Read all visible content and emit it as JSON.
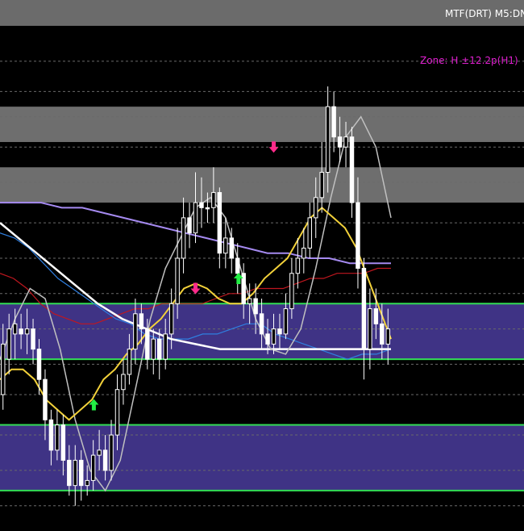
{
  "header": {
    "title": "MTF(DRT) M5:DN"
  },
  "zone_label": "Zone: H ±12.2p(H1)",
  "colors": {
    "background": "#000000",
    "header_bar": "#6b6b6b",
    "gray_zone": "#6e6e6e",
    "purple_zone": "#3f3385",
    "green_line": "#33dd55",
    "dashed_grid": "#6a6a6a",
    "candle": "#ffffff",
    "yellow_ma": "#f2d13a",
    "red_ma": "#c0171f",
    "blue_ma": "#2f7fe0",
    "violet_ma": "#a58af0",
    "white_ma": "#ffffff",
    "gray_osc": "#c0c0c0",
    "arrow_up": "#22ee44",
    "arrow_down": "#ff2a8a",
    "zone_text": "#e020d0"
  },
  "chart_data": {
    "type": "candlestick",
    "title": "MTF(DRT) M5:DN",
    "y_scale": "price index (unlabelled, 0 = top, 1 = bottom of plot)",
    "gray_zones": [
      [
        0.16,
        0.23
      ],
      [
        0.28,
        0.35
      ]
    ],
    "purple_zones": [
      [
        0.55,
        0.66
      ],
      [
        0.79,
        0.92
      ]
    ],
    "green_lines": [
      0.55,
      0.66,
      0.79,
      0.92
    ],
    "dashed_grid_levels": [
      0.07,
      0.13,
      0.18,
      0.24,
      0.31,
      0.39,
      0.46,
      0.53,
      0.6,
      0.67,
      0.73,
      0.81,
      0.88,
      0.95
    ],
    "candles": [
      [
        0.73,
        0.63,
        0.59,
        0.76
      ],
      [
        0.66,
        0.6,
        0.57,
        0.69
      ],
      [
        0.61,
        0.59,
        0.56,
        0.66
      ],
      [
        0.6,
        0.61,
        0.57,
        0.64
      ],
      [
        0.61,
        0.6,
        0.56,
        0.65
      ],
      [
        0.6,
        0.64,
        0.58,
        0.67
      ],
      [
        0.64,
        0.7,
        0.62,
        0.73
      ],
      [
        0.7,
        0.78,
        0.68,
        0.82
      ],
      [
        0.78,
        0.84,
        0.76,
        0.87
      ],
      [
        0.84,
        0.79,
        0.76,
        0.86
      ],
      [
        0.79,
        0.86,
        0.77,
        0.89
      ],
      [
        0.86,
        0.91,
        0.83,
        0.93
      ],
      [
        0.91,
        0.86,
        0.83,
        0.95
      ],
      [
        0.86,
        0.91,
        0.84,
        0.94
      ],
      [
        0.91,
        0.9,
        0.87,
        0.93
      ],
      [
        0.9,
        0.85,
        0.82,
        0.92
      ],
      [
        0.85,
        0.84,
        0.8,
        0.88
      ],
      [
        0.84,
        0.88,
        0.81,
        0.9
      ],
      [
        0.88,
        0.81,
        0.78,
        0.9
      ],
      [
        0.81,
        0.72,
        0.69,
        0.84
      ],
      [
        0.72,
        0.69,
        0.66,
        0.75
      ],
      [
        0.69,
        0.64,
        0.61,
        0.71
      ],
      [
        0.64,
        0.57,
        0.54,
        0.67
      ],
      [
        0.57,
        0.6,
        0.55,
        0.63
      ],
      [
        0.6,
        0.66,
        0.58,
        0.68
      ],
      [
        0.66,
        0.62,
        0.6,
        0.69
      ],
      [
        0.62,
        0.66,
        0.6,
        0.7
      ],
      [
        0.66,
        0.61,
        0.58,
        0.68
      ],
      [
        0.61,
        0.55,
        0.52,
        0.64
      ],
      [
        0.55,
        0.46,
        0.4,
        0.58
      ],
      [
        0.46,
        0.38,
        0.34,
        0.49
      ],
      [
        0.38,
        0.41,
        0.35,
        0.44
      ],
      [
        0.41,
        0.35,
        0.29,
        0.43
      ],
      [
        0.35,
        0.36,
        0.3,
        0.4
      ],
      [
        0.36,
        0.36,
        0.33,
        0.39
      ],
      [
        0.36,
        0.33,
        0.28,
        0.39
      ],
      [
        0.33,
        0.45,
        0.32,
        0.48
      ],
      [
        0.45,
        0.42,
        0.38,
        0.48
      ],
      [
        0.42,
        0.46,
        0.4,
        0.49
      ],
      [
        0.46,
        0.49,
        0.43,
        0.53
      ],
      [
        0.49,
        0.55,
        0.47,
        0.58
      ],
      [
        0.55,
        0.54,
        0.51,
        0.59
      ],
      [
        0.54,
        0.57,
        0.51,
        0.61
      ],
      [
        0.57,
        0.61,
        0.54,
        0.64
      ],
      [
        0.61,
        0.63,
        0.58,
        0.65
      ],
      [
        0.63,
        0.6,
        0.57,
        0.65
      ],
      [
        0.6,
        0.61,
        0.57,
        0.64
      ],
      [
        0.61,
        0.56,
        0.53,
        0.62
      ],
      [
        0.56,
        0.49,
        0.46,
        0.58
      ],
      [
        0.49,
        0.46,
        0.42,
        0.52
      ],
      [
        0.46,
        0.44,
        0.4,
        0.49
      ],
      [
        0.44,
        0.38,
        0.35,
        0.46
      ],
      [
        0.38,
        0.34,
        0.3,
        0.42
      ],
      [
        0.34,
        0.29,
        0.23,
        0.37
      ],
      [
        0.29,
        0.16,
        0.12,
        0.33
      ],
      [
        0.16,
        0.22,
        0.13,
        0.25
      ],
      [
        0.22,
        0.24,
        0.18,
        0.27
      ],
      [
        0.24,
        0.22,
        0.19,
        0.28
      ],
      [
        0.22,
        0.35,
        0.2,
        0.38
      ],
      [
        0.35,
        0.48,
        0.3,
        0.52
      ],
      [
        0.48,
        0.64,
        0.46,
        0.7
      ],
      [
        0.64,
        0.56,
        0.52,
        0.68
      ],
      [
        0.56,
        0.59,
        0.52,
        0.62
      ],
      [
        0.59,
        0.63,
        0.55,
        0.66
      ],
      [
        0.63,
        0.6,
        0.56,
        0.67
      ]
    ],
    "yellow_ma": [
      0.7,
      0.68,
      0.68,
      0.7,
      0.74,
      0.76,
      0.78,
      0.76,
      0.74,
      0.7,
      0.68,
      0.65,
      0.63,
      0.6,
      0.58,
      0.55,
      0.52,
      0.51,
      0.52,
      0.54,
      0.55,
      0.55,
      0.53,
      0.5,
      0.48,
      0.46,
      0.42,
      0.38,
      0.36,
      0.38,
      0.4,
      0.44,
      0.5,
      0.56,
      0.62
    ],
    "red_ma": [
      0.49,
      0.5,
      0.52,
      0.55,
      0.57,
      0.58,
      0.59,
      0.59,
      0.58,
      0.57,
      0.56,
      0.56,
      0.55,
      0.55,
      0.55,
      0.55,
      0.54,
      0.53,
      0.53,
      0.52,
      0.52,
      0.52,
      0.51,
      0.5,
      0.5,
      0.49,
      0.49,
      0.49,
      0.48,
      0.48
    ],
    "blue_ma": [
      0.41,
      0.42,
      0.44,
      0.47,
      0.5,
      0.52,
      0.54,
      0.56,
      0.58,
      0.59,
      0.61,
      0.62,
      0.62,
      0.62,
      0.61,
      0.61,
      0.6,
      0.59,
      0.59,
      0.61,
      0.62,
      0.63,
      0.64,
      0.65,
      0.66,
      0.65,
      0.65,
      0.64
    ],
    "violet_ma": [
      0.35,
      0.35,
      0.35,
      0.36,
      0.36,
      0.37,
      0.38,
      0.39,
      0.4,
      0.41,
      0.42,
      0.43,
      0.44,
      0.45,
      0.45,
      0.46,
      0.46,
      0.47,
      0.47,
      0.47
    ],
    "white_ma": [
      0.39,
      0.43,
      0.47,
      0.51,
      0.55,
      0.58,
      0.6,
      0.62,
      0.63,
      0.64,
      0.64,
      0.64,
      0.64,
      0.64,
      0.64,
      0.64,
      0.64
    ],
    "gray_osc": [
      0.66,
      0.58,
      0.52,
      0.54,
      0.64,
      0.78,
      0.88,
      0.92,
      0.86,
      0.72,
      0.58,
      0.48,
      0.42,
      0.36,
      0.34,
      0.38,
      0.48,
      0.58,
      0.64,
      0.65,
      0.6,
      0.48,
      0.34,
      0.22,
      0.18,
      0.24,
      0.38
    ],
    "arrows_up": [
      [
        0.24,
        0.75
      ],
      [
        0.61,
        0.5
      ]
    ],
    "arrows_down": [
      [
        0.5,
        0.52
      ],
      [
        0.7,
        0.24
      ]
    ]
  }
}
